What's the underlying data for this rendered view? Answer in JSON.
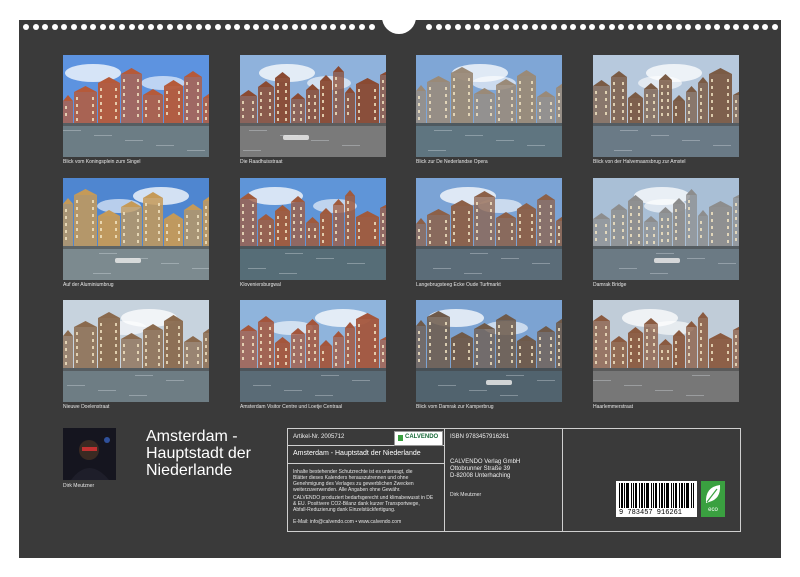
{
  "photos": [
    {
      "caption": "Blick vom Koningsplein zum Singel"
    },
    {
      "caption": "Die Raadhuisstraat"
    },
    {
      "caption": "Blick zur De Nederlandse Opera"
    },
    {
      "caption": "Blick von der Halvemaansbrug zur Amstel"
    },
    {
      "caption": "Auf der Aluminiumbrug"
    },
    {
      "caption": "Kloveniersburgwal"
    },
    {
      "caption": "Langebrugsteeg Ecke Oude Turfmarkt"
    },
    {
      "caption": "Damrak Bridge"
    },
    {
      "caption": "Nieuwe Doelenstraat"
    },
    {
      "caption": "Amsterdam Visitor Centre und Loetje Centraal"
    },
    {
      "caption": "Blick vom Damrak zur Kamperbrug"
    },
    {
      "caption": "Haarlemmerstraat"
    }
  ],
  "title_lines": [
    "Amsterdam -",
    "Hauptstadt der",
    "Niederlande"
  ],
  "author": "Dirk Meutzner",
  "info": {
    "article": "Artikel-Nr. 2005712",
    "logo": "CALVENDO",
    "isbn": "ISBN 9783457916261",
    "calendar_title": "Amsterdam - Hauptstadt der Niederlande",
    "legal_lines": [
      "Inhalte bestehender Schutzrechte ist es untersagt, die",
      "Blätter dieses Kalenders herauszutrennen und ohne",
      "Genehmigung des Verlages zu gewerblichen Zwecken",
      "weiterzuverwenden. Alle Angaben ohne Gewähr."
    ],
    "eco_lines": [
      "CALVENDO produziert bedarfsgerecht und klimabewusst in DE",
      "& EU. Positivere CO2-Bilanz dank kurzer Transportwege,",
      "Abfall-Reduzierung dank Einzelstückfertigung."
    ],
    "publisher_lines": [
      "CALVENDO Verlag GmbH",
      "Ottobrunner Straße 39",
      "D-82008 Unterhaching"
    ],
    "photographer": "Dirk Meutzner",
    "contact": "E-Mail: info@calvendo.com • www.calvendo.com",
    "barcode_digits": "9 783457 916261",
    "eco_label": "eco"
  },
  "colors": {
    "board": "#3a3a3a",
    "sky": "#6f9fd8",
    "water": "#5b6c78"
  }
}
